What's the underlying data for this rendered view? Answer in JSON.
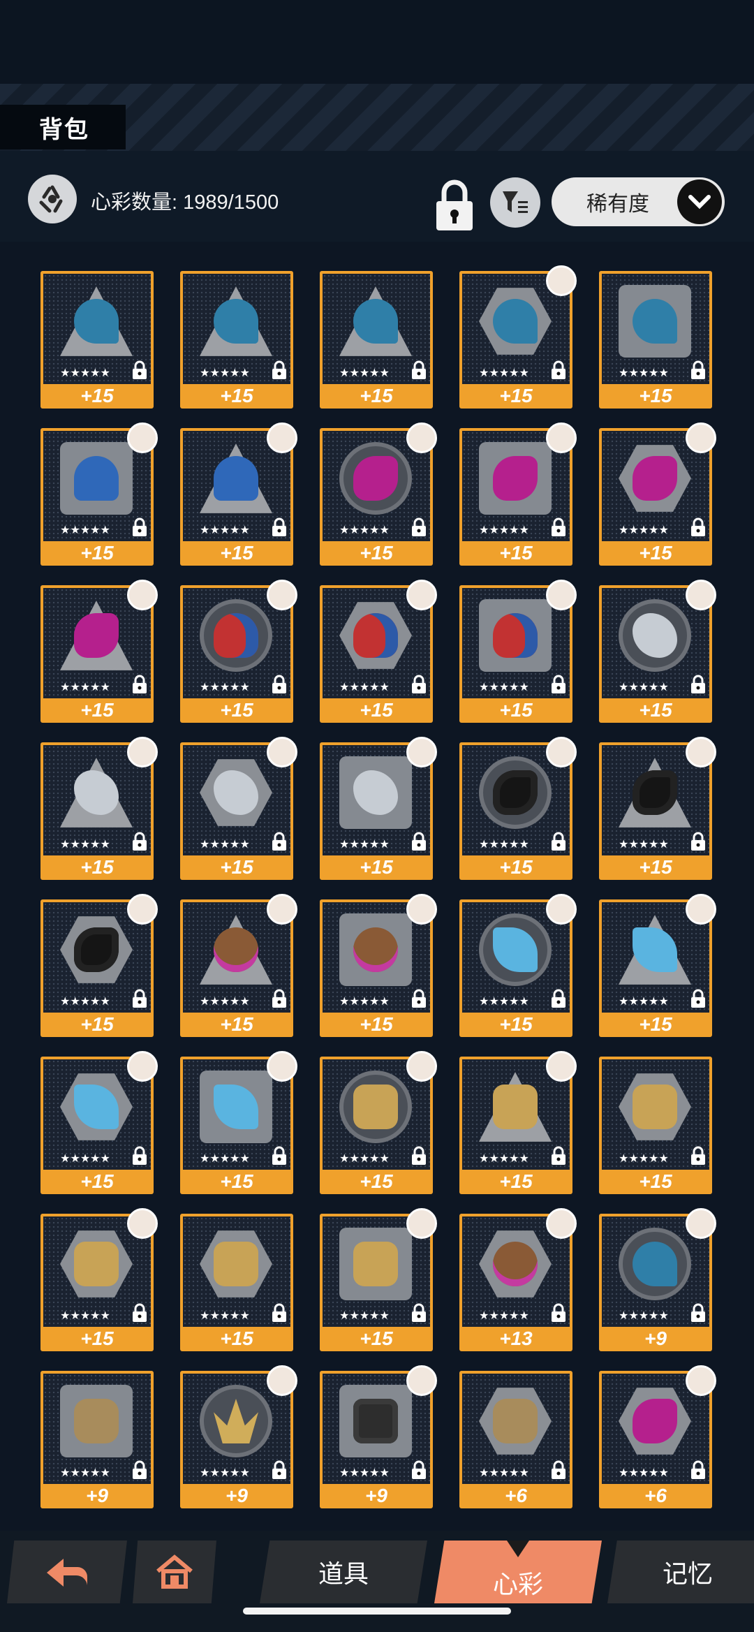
{
  "header": {
    "title": "背包"
  },
  "toolbar": {
    "count_text": "心彩数量: 1989/1500",
    "sort_label": "稀有度"
  },
  "colors": {
    "card_border": "#f0a12c",
    "active_tab": "#ef8a66",
    "background": "#0d1623"
  },
  "items": [
    {
      "shape": "triangle",
      "art": "hook",
      "stars": "★★★★★",
      "level": "+15",
      "avatar": false
    },
    {
      "shape": "triangle",
      "art": "hook",
      "stars": "★★★★★",
      "level": "+15",
      "avatar": false
    },
    {
      "shape": "triangle",
      "art": "hook",
      "stars": "★★★★★",
      "level": "+15",
      "avatar": false
    },
    {
      "shape": "hexagon",
      "art": "hook",
      "stars": "★★★★★",
      "level": "+15",
      "avatar": true
    },
    {
      "shape": "square",
      "art": "hook",
      "stars": "★★★★★",
      "level": "+15",
      "avatar": false
    },
    {
      "shape": "square",
      "art": "umbrella",
      "stars": "★★★★★",
      "level": "+15",
      "avatar": true
    },
    {
      "shape": "triangle",
      "art": "umbrella",
      "stars": "★★★★★",
      "level": "+15",
      "avatar": true
    },
    {
      "shape": "circle",
      "art": "hair",
      "stars": "★★★★★",
      "level": "+15",
      "avatar": true
    },
    {
      "shape": "square",
      "art": "hair",
      "stars": "★★★★★",
      "level": "+15",
      "avatar": true
    },
    {
      "shape": "hexagon",
      "art": "hair",
      "stars": "★★★★★",
      "level": "+15",
      "avatar": true
    },
    {
      "shape": "triangle",
      "art": "hair",
      "stars": "★★★★★",
      "level": "+15",
      "avatar": true
    },
    {
      "shape": "circle",
      "art": "hat",
      "stars": "★★★★★",
      "level": "+15",
      "avatar": true
    },
    {
      "shape": "hexagon",
      "art": "hat",
      "stars": "★★★★★",
      "level": "+15",
      "avatar": true
    },
    {
      "shape": "square",
      "art": "hat",
      "stars": "★★★★★",
      "level": "+15",
      "avatar": true
    },
    {
      "shape": "circle",
      "art": "bird",
      "stars": "★★★★★",
      "level": "+15",
      "avatar": true
    },
    {
      "shape": "triangle",
      "art": "bird",
      "stars": "★★★★★",
      "level": "+15",
      "avatar": true
    },
    {
      "shape": "hexagon",
      "art": "bird",
      "stars": "★★★★★",
      "level": "+15",
      "avatar": true
    },
    {
      "shape": "square",
      "art": "bird",
      "stars": "★★★★★",
      "level": "+15",
      "avatar": true
    },
    {
      "shape": "circle",
      "art": "blackbird",
      "stars": "★★★★★",
      "level": "+15",
      "avatar": true
    },
    {
      "shape": "triangle",
      "art": "blackbird",
      "stars": "★★★★★",
      "level": "+15",
      "avatar": true
    },
    {
      "shape": "hexagon",
      "art": "blackbird",
      "stars": "★★★★★",
      "level": "+15",
      "avatar": true
    },
    {
      "shape": "triangle",
      "art": "gear",
      "stars": "★★★★★",
      "level": "+15",
      "avatar": true
    },
    {
      "shape": "square",
      "art": "gear",
      "stars": "★★★★★",
      "level": "+15",
      "avatar": true
    },
    {
      "shape": "circle",
      "art": "trident",
      "stars": "★★★★★",
      "level": "+15",
      "avatar": true
    },
    {
      "shape": "triangle",
      "art": "trident",
      "stars": "★★★★★",
      "level": "+15",
      "avatar": true
    },
    {
      "shape": "hexagon",
      "art": "trident",
      "stars": "★★★★★",
      "level": "+15",
      "avatar": true
    },
    {
      "shape": "square",
      "art": "trident",
      "stars": "★★★★★",
      "level": "+15",
      "avatar": true
    },
    {
      "shape": "circle",
      "art": "hammer",
      "stars": "★★★★★",
      "level": "+15",
      "avatar": true
    },
    {
      "shape": "triangle",
      "art": "hammer",
      "stars": "★★★★★",
      "level": "+15",
      "avatar": true
    },
    {
      "shape": "hexagon",
      "art": "hammer",
      "stars": "★★★★★",
      "level": "+15",
      "avatar": false
    },
    {
      "shape": "hexagon",
      "art": "hammer",
      "stars": "★★★★★",
      "level": "+15",
      "avatar": true
    },
    {
      "shape": "hexagon",
      "art": "hammer",
      "stars": "★★★★★",
      "level": "+15",
      "avatar": false
    },
    {
      "shape": "square",
      "art": "hammer",
      "stars": "★★★★★",
      "level": "+15",
      "avatar": true
    },
    {
      "shape": "hexagon",
      "art": "gear",
      "stars": "★★★★★",
      "level": "+13",
      "avatar": true
    },
    {
      "shape": "circle",
      "art": "hook",
      "stars": "★★★★★",
      "level": "+9",
      "avatar": true
    },
    {
      "shape": "square",
      "art": "pipe",
      "stars": "★★★★★",
      "level": "+9",
      "avatar": false
    },
    {
      "shape": "circle",
      "art": "spike",
      "stars": "★★★★★",
      "level": "+9",
      "avatar": true
    },
    {
      "shape": "square",
      "art": "light",
      "stars": "★★★★★",
      "level": "+9",
      "avatar": true
    },
    {
      "shape": "hexagon",
      "art": "pipe",
      "stars": "★★★★★",
      "level": "+6",
      "avatar": false
    },
    {
      "shape": "hexagon",
      "art": "hair",
      "stars": "★★★★★",
      "level": "+6",
      "avatar": true
    }
  ],
  "nav": {
    "back_icon": "back-arrow-icon",
    "home_icon": "home-icon",
    "tabs": [
      {
        "label": "道具",
        "active": false
      },
      {
        "label": "心彩",
        "active": true
      },
      {
        "label": "记忆",
        "active": false
      }
    ]
  }
}
